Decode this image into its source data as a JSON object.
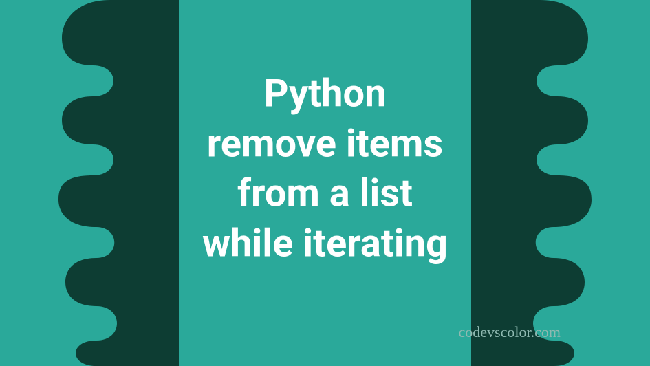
{
  "title": {
    "line1": "Python",
    "line2": "remove items",
    "line3": "from a list",
    "line4": "while iterating"
  },
  "watermark": "codevscolor.com",
  "colors": {
    "bg_light": "#2aa99a",
    "bg_dark": "#0d3d33",
    "text": "#ffffff",
    "watermark": "#8fb9b1"
  }
}
